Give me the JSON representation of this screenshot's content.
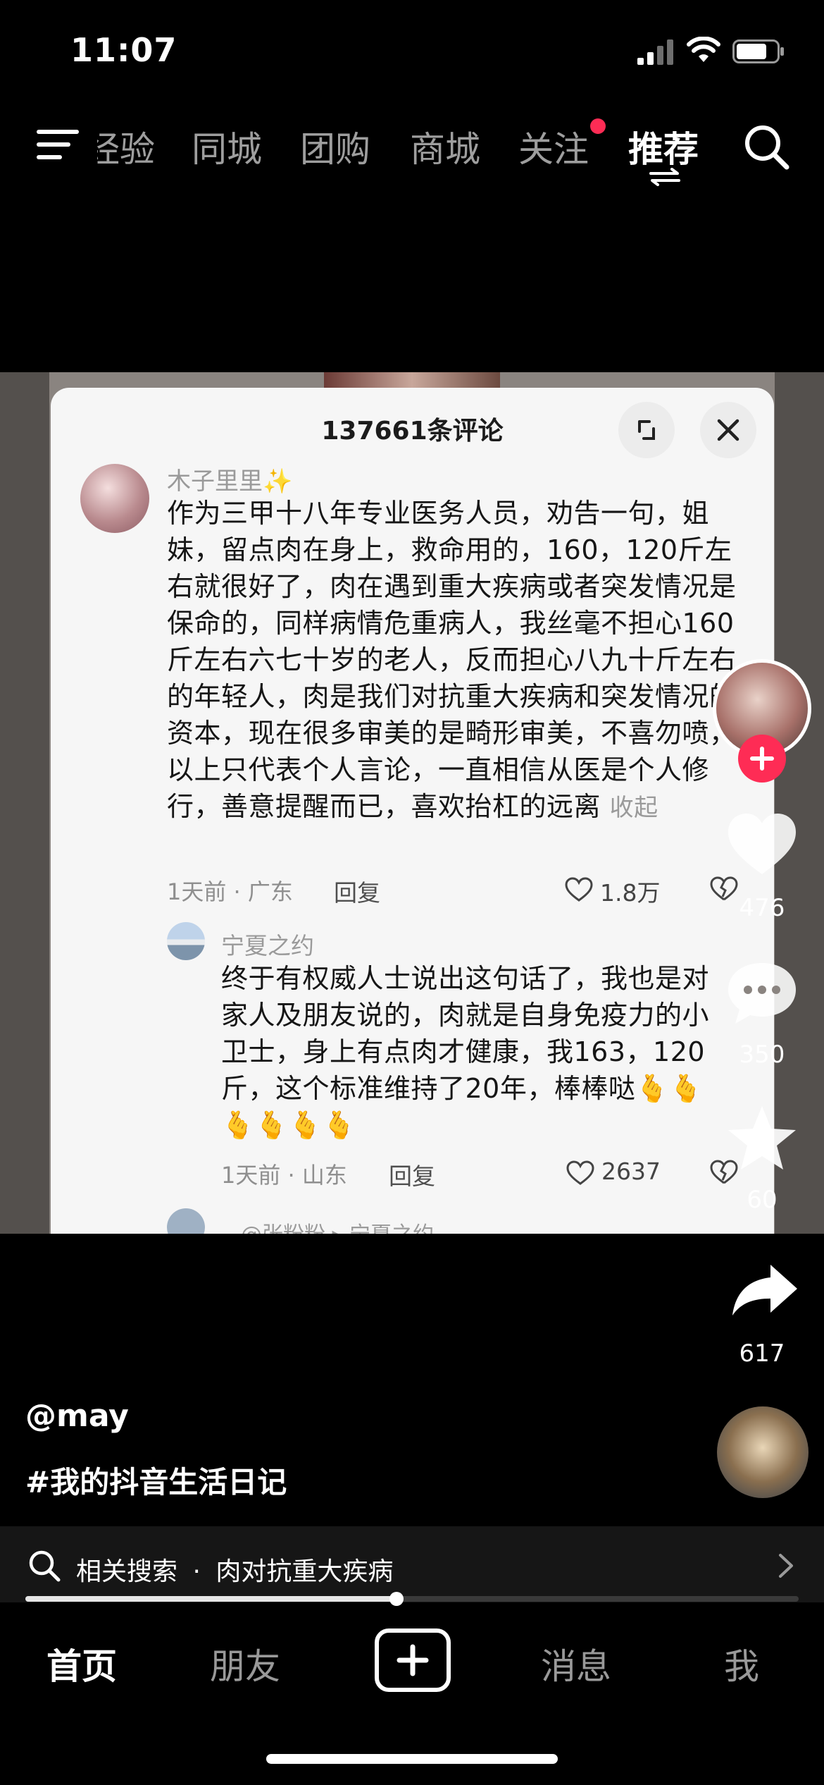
{
  "status_bar": {
    "time": "11:07"
  },
  "top_nav": {
    "tabs": [
      {
        "label": "经验",
        "active": false
      },
      {
        "label": "同城",
        "active": false
      },
      {
        "label": "团购",
        "active": false
      },
      {
        "label": "商城",
        "active": false
      },
      {
        "label": "关注",
        "active": false,
        "has_dot": true
      },
      {
        "label": "推荐",
        "active": true
      }
    ],
    "icons": {
      "menu": "menu-icon",
      "search": "search-icon",
      "swap": "swap-arrows-icon"
    }
  },
  "comments_card": {
    "title": "137661条评论",
    "comment": {
      "user": "木子里里✨",
      "text": "作为三甲十八年专业医务人员，劝告一句，姐妹，留点肉在身上，救命用的，160，120斤左右就很好了，肉在遇到重大疾病或者突发情况是保命的，同样病情危重病人，我丝毫不担心160斤左右六七十岁的老人，反而担心八九十斤左右的年轻人，肉是我们对抗重大疾病和突发情况的资本，现在很多审美的是畸形审美，不喜勿喷，以上只代表个人言论，一直相信从医是个人修行，善意提醒而已，喜欢抬杠的远离",
      "fold_label": "收起",
      "meta": "1天前 · 广东",
      "reply_label": "回复",
      "likes": "1.8万"
    },
    "reply": {
      "user": "宁夏之约",
      "text": "终于有权威人士说出这句话了，我也是对家人及朋友说的，肉就是自身免疫力的小卫士，身上有点肉才健康，我163，120斤，这个标准维持了20年，棒棒哒🫰🫰🫰🫰🫰🫰",
      "meta": "1天前 · 山东",
      "reply_label": "回复",
      "likes": "2637"
    },
    "next_reply_peek": "@张粉粉 ▸ 宁夏之约"
  },
  "action_rail": {
    "likes": "476",
    "comments": "350",
    "favorites": "60",
    "shares": "617"
  },
  "caption": {
    "author": "@may",
    "hashtag": "#我的抖音生活日记"
  },
  "related_search": {
    "prefix": "相关搜索",
    "separator": "·",
    "query": "肉对抗重大疾病"
  },
  "progress": {
    "fraction": 0.48
  },
  "bottom_tabs": [
    {
      "label": "首页",
      "active": true
    },
    {
      "label": "朋友",
      "active": false
    },
    {
      "label": "消息",
      "active": false
    },
    {
      "label": "我",
      "active": false
    }
  ],
  "colors": {
    "accent": "#fe2c55",
    "background": "#000000"
  }
}
